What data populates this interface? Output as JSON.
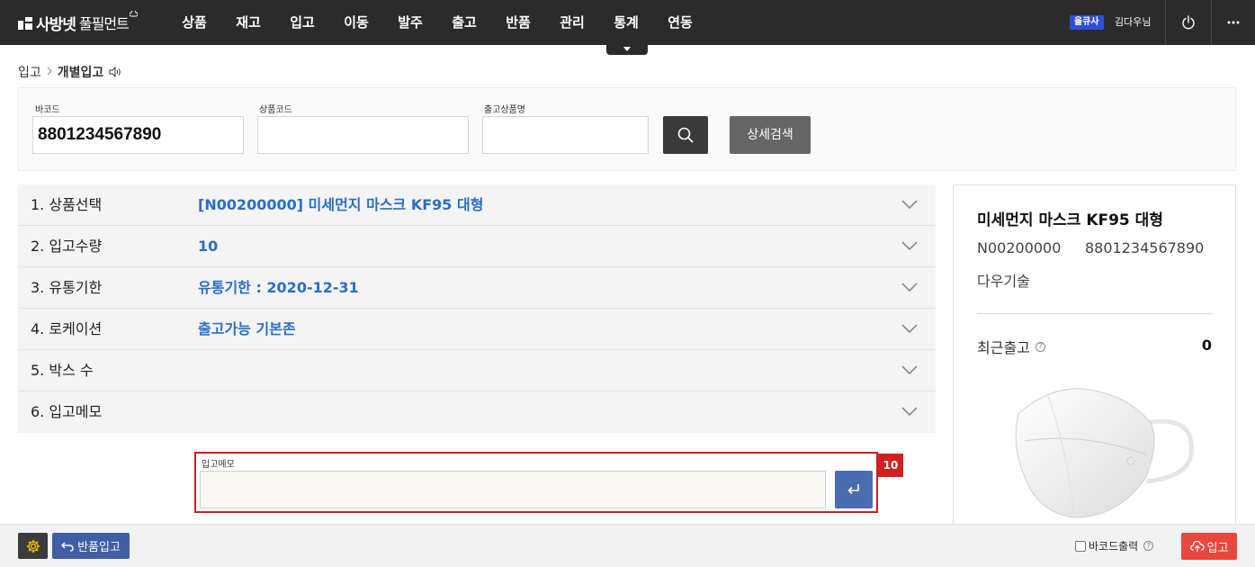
{
  "header": {
    "logo_main": "사방넷",
    "logo_sub": "풀필먼트",
    "nav": [
      "상품",
      "재고",
      "입고",
      "이동",
      "발주",
      "출고",
      "반품",
      "관리",
      "통계",
      "연동"
    ],
    "user_badge": "을큐사",
    "user_name": "김다우님",
    "icons": {
      "power": "power-icon",
      "more": "more-icon",
      "nav_toggle": "caret-down-icon"
    }
  },
  "breadcrumb": {
    "parent": "입고",
    "current": "개별입고"
  },
  "search": {
    "barcode_label": "바코드",
    "barcode_value": "8801234567890",
    "product_code_label": "상품코드",
    "product_code_value": "",
    "out_name_label": "출고상품명",
    "out_name_value": "",
    "detail_button": "상세검색"
  },
  "steps": [
    {
      "label": "1. 상품선택",
      "value": "[N00200000] 미세먼지 마스크 KF95 대형"
    },
    {
      "label": "2. 입고수량",
      "value": "10"
    },
    {
      "label": "3. 유통기한",
      "value": "유통기한 : 2020-12-31"
    },
    {
      "label": "4. 로케이션",
      "value": "출고가능 기본존"
    },
    {
      "label": "5. 박스 수",
      "value": ""
    },
    {
      "label": "6. 입고메모",
      "value": ""
    }
  ],
  "memo": {
    "label": "입고메모",
    "value": "",
    "count": "10"
  },
  "product": {
    "name": "미세먼지 마스크 KF95 대형",
    "code": "N00200000",
    "barcode": "8801234567890",
    "vendor": "다우기술",
    "recent_label": "최근출고",
    "recent_value": "0"
  },
  "footer": {
    "return_button": "반품입고",
    "barcode_print_label": "바코드출력",
    "barcode_print_checked": false,
    "inbound_button": "입고"
  },
  "colors": {
    "accent_blue": "#2a6ec7",
    "highlight_red": "#d21f1f",
    "topbar": "#2b2b2b",
    "inbound_red": "#e8473e"
  }
}
